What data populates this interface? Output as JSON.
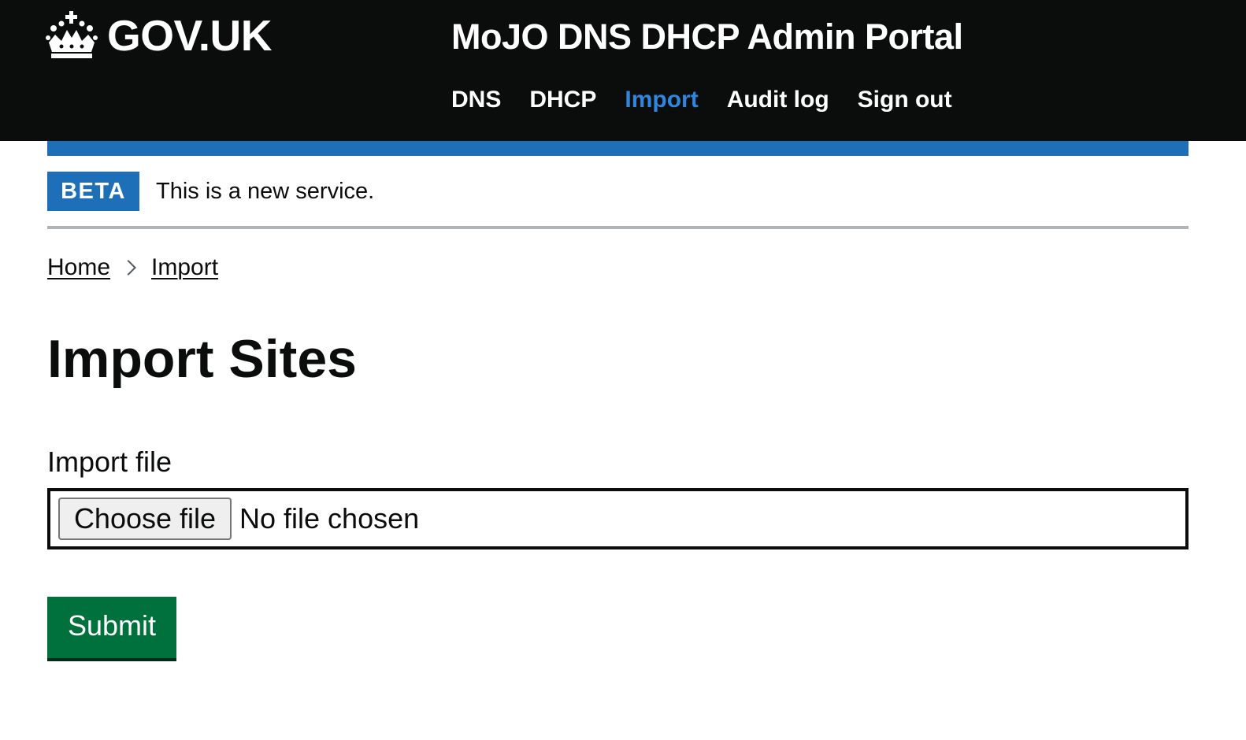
{
  "header": {
    "logo_text": "GOV.UK",
    "service_name": "MoJO DNS DHCP Admin Portal",
    "nav": [
      {
        "label": "DNS",
        "active": false
      },
      {
        "label": "DHCP",
        "active": false
      },
      {
        "label": "Import",
        "active": true
      },
      {
        "label": "Audit log",
        "active": false
      },
      {
        "label": "Sign out",
        "active": false
      }
    ]
  },
  "phase_banner": {
    "tag": "BETA",
    "text": "This is a new service."
  },
  "breadcrumb": [
    {
      "label": "Home"
    },
    {
      "label": "Import"
    }
  ],
  "main": {
    "title": "Import Sites",
    "file_field": {
      "label": "Import file",
      "button_label": "Choose file",
      "status": "No file chosen"
    },
    "submit_label": "Submit"
  },
  "colors": {
    "header_bg": "#0b0c0c",
    "brand_blue": "#1d70b8",
    "active_nav": "#2e86de",
    "submit_green": "#00703c",
    "divider": "#b1b4b6"
  },
  "icons": {
    "logo": "crown-icon",
    "breadcrumb_separator": "chevron-right-icon"
  }
}
